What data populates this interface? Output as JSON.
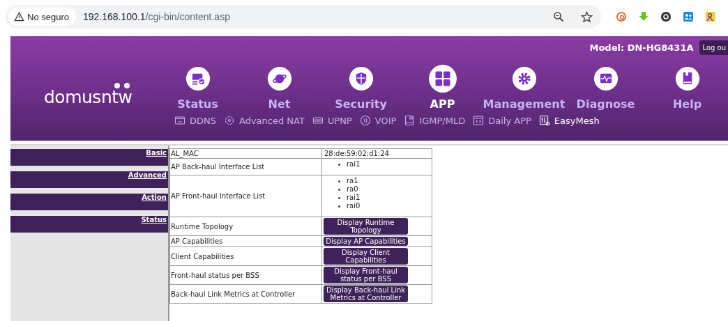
{
  "browser": {
    "security_label": "No seguro",
    "url_host": "192.168.100.1",
    "url_path": "/cgi-bin/content.asp"
  },
  "header": {
    "logo": "domusntw",
    "model": "Model: DN-HG8431A",
    "logout": "Log ou"
  },
  "nav": [
    {
      "label": "Status",
      "selected": false
    },
    {
      "label": "Net",
      "selected": false
    },
    {
      "label": "Security",
      "selected": false
    },
    {
      "label": "APP",
      "selected": true
    },
    {
      "label": "Management",
      "selected": false
    },
    {
      "label": "Diagnose",
      "selected": false
    },
    {
      "label": "Help",
      "selected": false
    }
  ],
  "subnav": [
    {
      "label": "DDNS",
      "selected": false
    },
    {
      "label": "Advanced NAT",
      "selected": false
    },
    {
      "label": "UPNP",
      "selected": false
    },
    {
      "label": "VOIP",
      "selected": false
    },
    {
      "label": "IGMP/MLD",
      "selected": false
    },
    {
      "label": "Daily APP",
      "selected": false
    },
    {
      "label": "EasyMesh",
      "selected": true
    }
  ],
  "sidebar": [
    {
      "label": "Basic"
    },
    {
      "label": "Advanced"
    },
    {
      "label": "Action"
    },
    {
      "label": "Status"
    }
  ],
  "table": {
    "rows": [
      {
        "kind": "text",
        "label": "AL_MAC",
        "value": "28:de:59:02:d1:24"
      },
      {
        "kind": "list",
        "label": "AP Back-haul Interface List",
        "items": [
          "rai1"
        ]
      },
      {
        "kind": "list",
        "label": "AP Front-haul Interface List",
        "items": [
          "ra1",
          "ra0",
          "rai1",
          "rai0"
        ]
      },
      {
        "kind": "button",
        "label": "Runtime Topology",
        "button": "Display Runtime Topology"
      },
      {
        "kind": "button",
        "label": "AP Capabilities",
        "button": "Display AP Capabilities"
      },
      {
        "kind": "button",
        "label": "Client Capabilities",
        "button": "Display Client Capabilities"
      },
      {
        "kind": "button",
        "label": "Front-haul status per BSS",
        "button": "Display Front-haul status per BSS"
      },
      {
        "kind": "button",
        "label": "Back-haul Link Metrics at Controller",
        "button": "Display Back-haul Link Metrics at Controller"
      }
    ]
  }
}
